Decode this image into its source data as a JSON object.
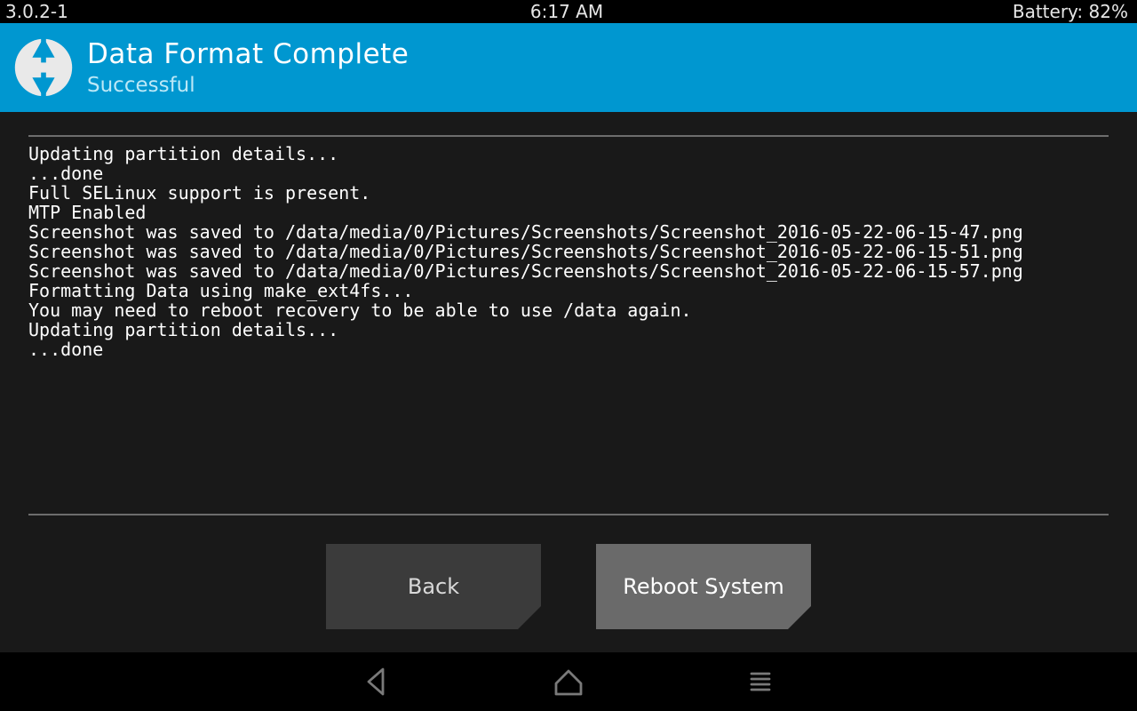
{
  "status": {
    "version": "3.0.2-1",
    "time": "6:17 AM",
    "battery": "Battery: 82%"
  },
  "header": {
    "title": "Data Format Complete",
    "subtitle": "Successful"
  },
  "log_lines": [
    "Updating partition details...",
    "...done",
    "Full SELinux support is present.",
    "MTP Enabled",
    "Screenshot was saved to /data/media/0/Pictures/Screenshots/Screenshot_2016-05-22-06-15-47.png",
    "Screenshot was saved to /data/media/0/Pictures/Screenshots/Screenshot_2016-05-22-06-15-51.png",
    "Screenshot was saved to /data/media/0/Pictures/Screenshots/Screenshot_2016-05-22-06-15-57.png",
    "Formatting Data using make_ext4fs...",
    "You may need to reboot recovery to be able to use /data again.",
    "Updating partition details...",
    "...done"
  ],
  "buttons": {
    "back": "Back",
    "reboot": "Reboot System"
  },
  "colors": {
    "accent": "#0097d0"
  }
}
